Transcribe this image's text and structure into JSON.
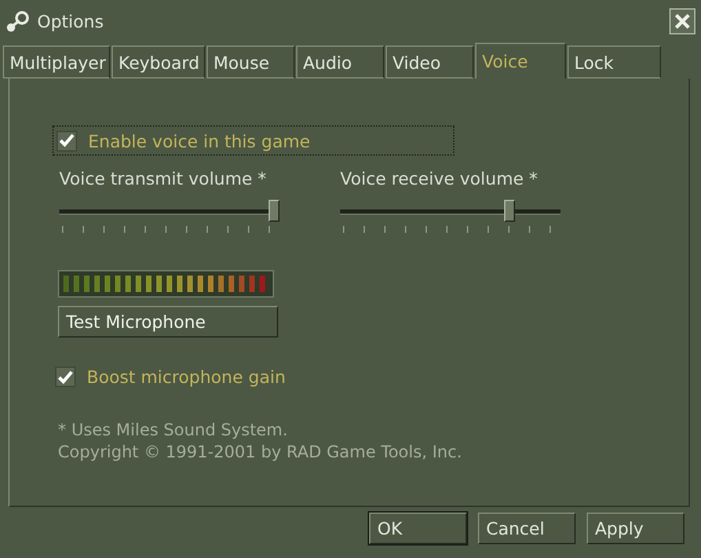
{
  "window": {
    "title": "Options"
  },
  "tabs": [
    {
      "label": "Multiplayer",
      "selected": false
    },
    {
      "label": "Keyboard",
      "selected": false
    },
    {
      "label": "Mouse",
      "selected": false
    },
    {
      "label": "Audio",
      "selected": false
    },
    {
      "label": "Video",
      "selected": false
    },
    {
      "label": "Voice",
      "selected": true
    },
    {
      "label": "Lock",
      "selected": false
    }
  ],
  "enable_voice": {
    "label": "Enable voice in this game",
    "checked": true
  },
  "sliders": [
    {
      "label": "Voice transmit volume *",
      "level": 1.0
    },
    {
      "label": "Voice receive volume *",
      "level": 0.78
    }
  ],
  "test_button": "Test Microphone",
  "boost_gain": {
    "label": "Boost microphone gain",
    "checked": true
  },
  "notes": [
    "* Uses Miles Sound System.",
    "Copyright © 1991-2001 by RAD Game Tools, Inc."
  ],
  "buttons": [
    {
      "label": "OK",
      "selected": true
    },
    {
      "label": "Cancel",
      "selected": false
    },
    {
      "label": "Apply",
      "selected": false
    }
  ]
}
